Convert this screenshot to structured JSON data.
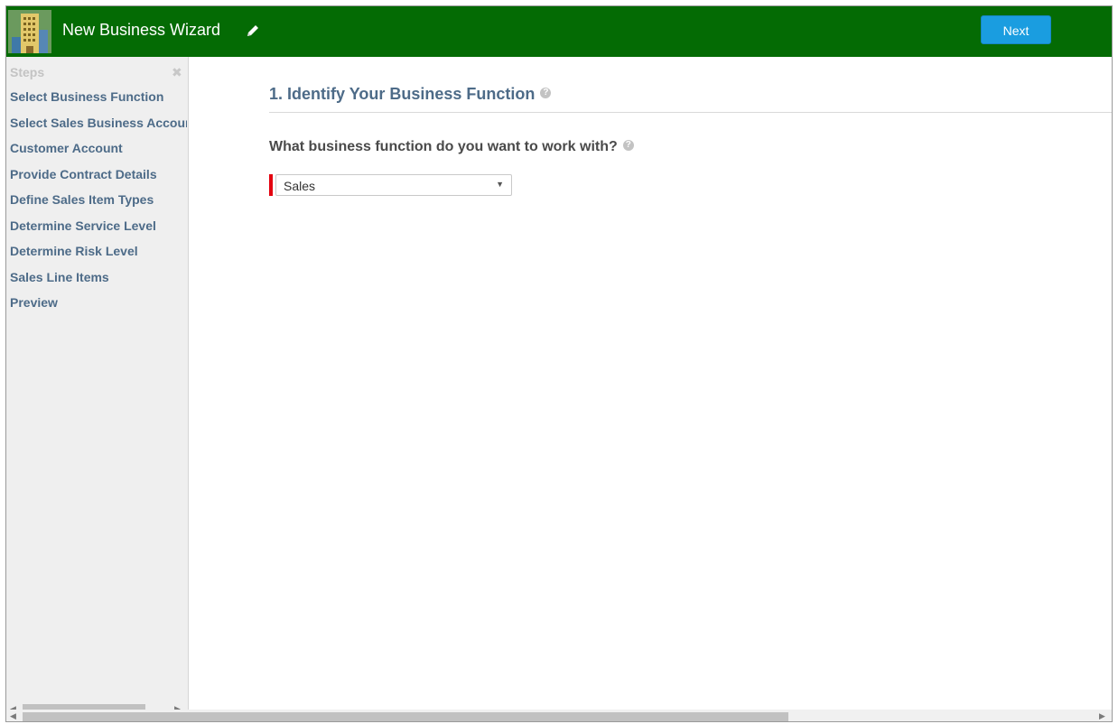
{
  "header": {
    "title": "New Business Wizard",
    "next_label": "Next",
    "brand_color": "#046b04",
    "button_color": "#1a9de0"
  },
  "sidebar": {
    "heading": "Steps",
    "close_glyph": "✖",
    "items": [
      {
        "label": "Select Business Function"
      },
      {
        "label": "Select Sales Business Account"
      },
      {
        "label": "Customer Account"
      },
      {
        "label": "Provide Contract Details"
      },
      {
        "label": "Define Sales Item Types"
      },
      {
        "label": "Determine Service Level"
      },
      {
        "label": "Determine Risk Level"
      },
      {
        "label": "Sales Line Items"
      },
      {
        "label": "Preview"
      }
    ]
  },
  "main": {
    "section_title": "1. Identify Your Business Function",
    "question": "What business function do you want to work with?",
    "business_function": {
      "selected": "Sales",
      "required": true
    }
  },
  "icons": {
    "logo": "building-icon",
    "edit": "pencil-icon",
    "help": "question-circle-icon",
    "close": "close-icon",
    "dropdown": "chevron-down-icon"
  }
}
